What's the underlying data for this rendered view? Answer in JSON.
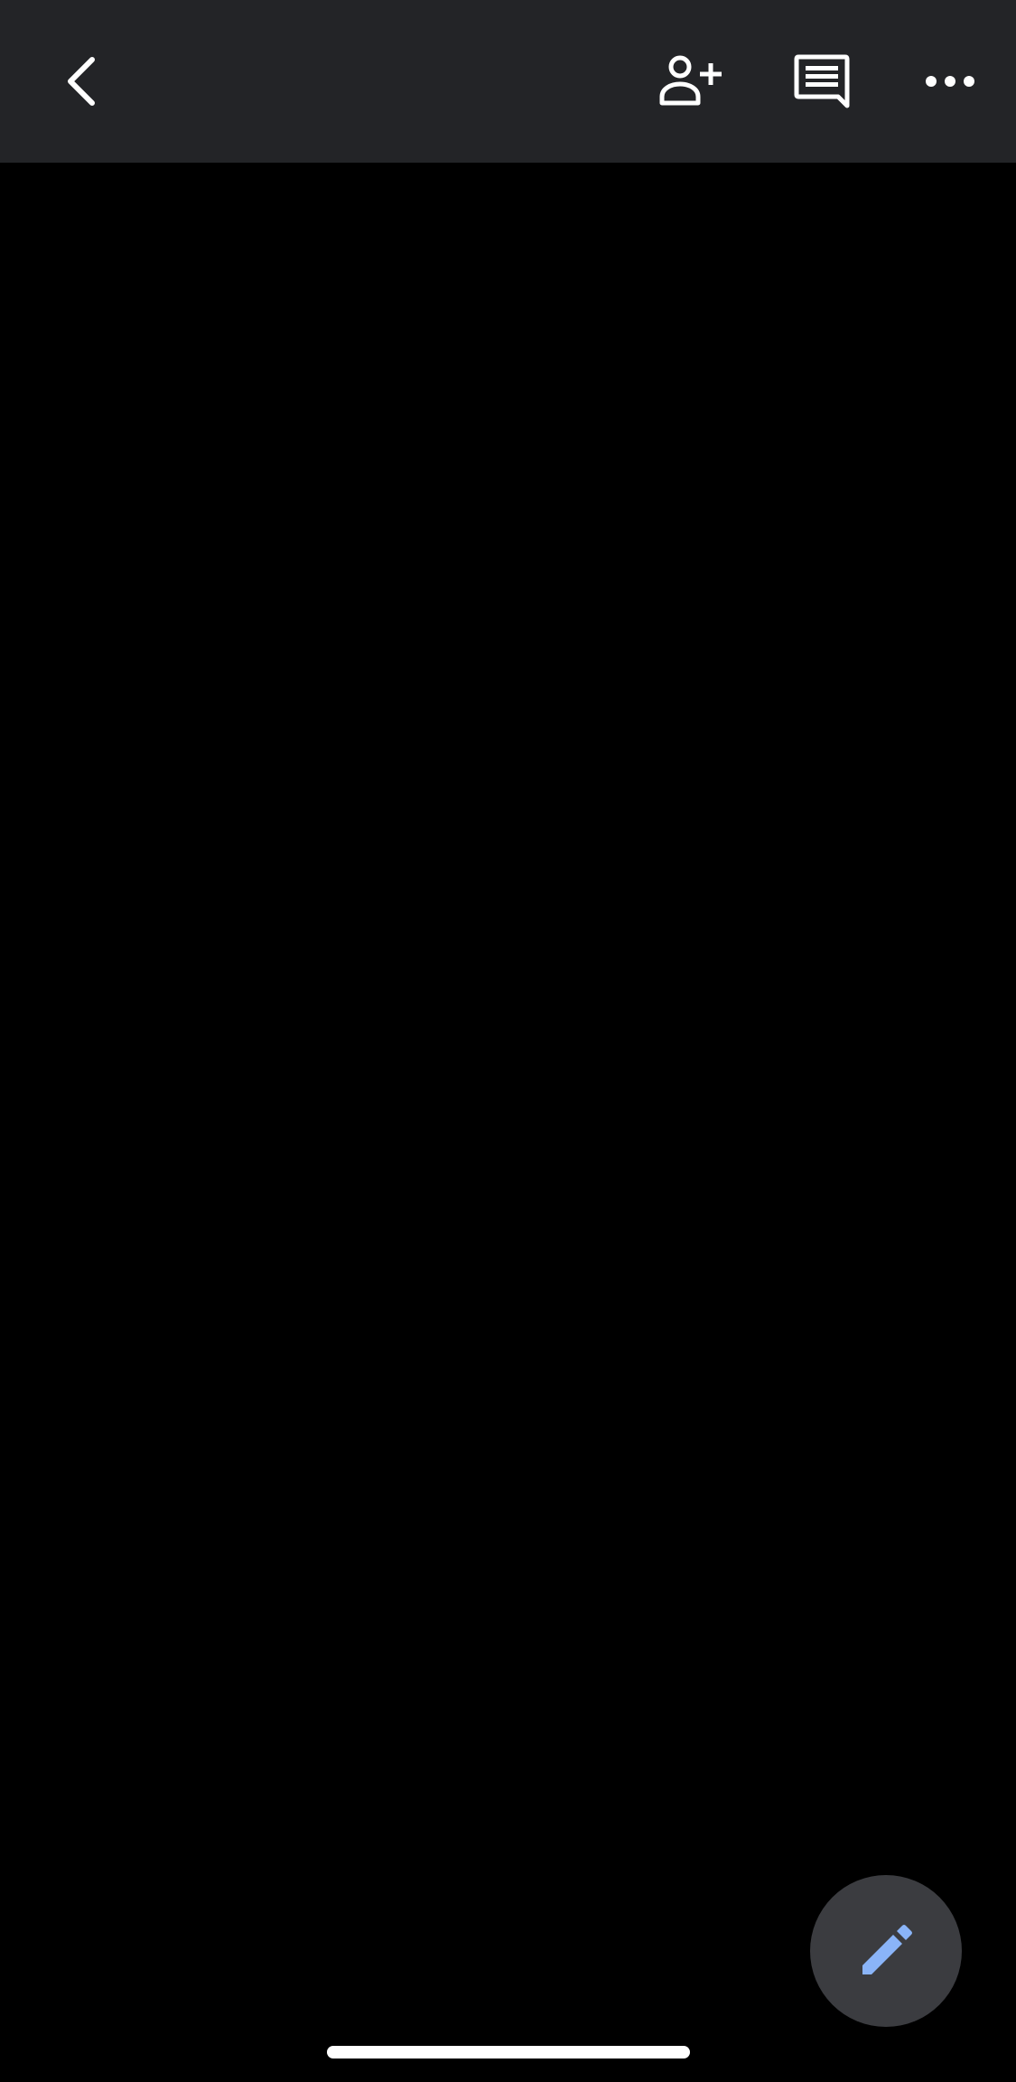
{
  "header": {
    "back_icon": "chevron-left-icon",
    "add_person_icon": "person-add-icon",
    "comments_icon": "comment-icon",
    "more_icon": "more-horizontal-icon",
    "background_color": "#232427",
    "icon_color": "#ffffff"
  },
  "document": {
    "background_color": "#000000"
  },
  "fab": {
    "icon": "pencil-edit-icon",
    "background_color": "#3b3c40",
    "icon_color": "#8ab4f8"
  },
  "system": {
    "home_indicator_color": "#ffffff"
  }
}
